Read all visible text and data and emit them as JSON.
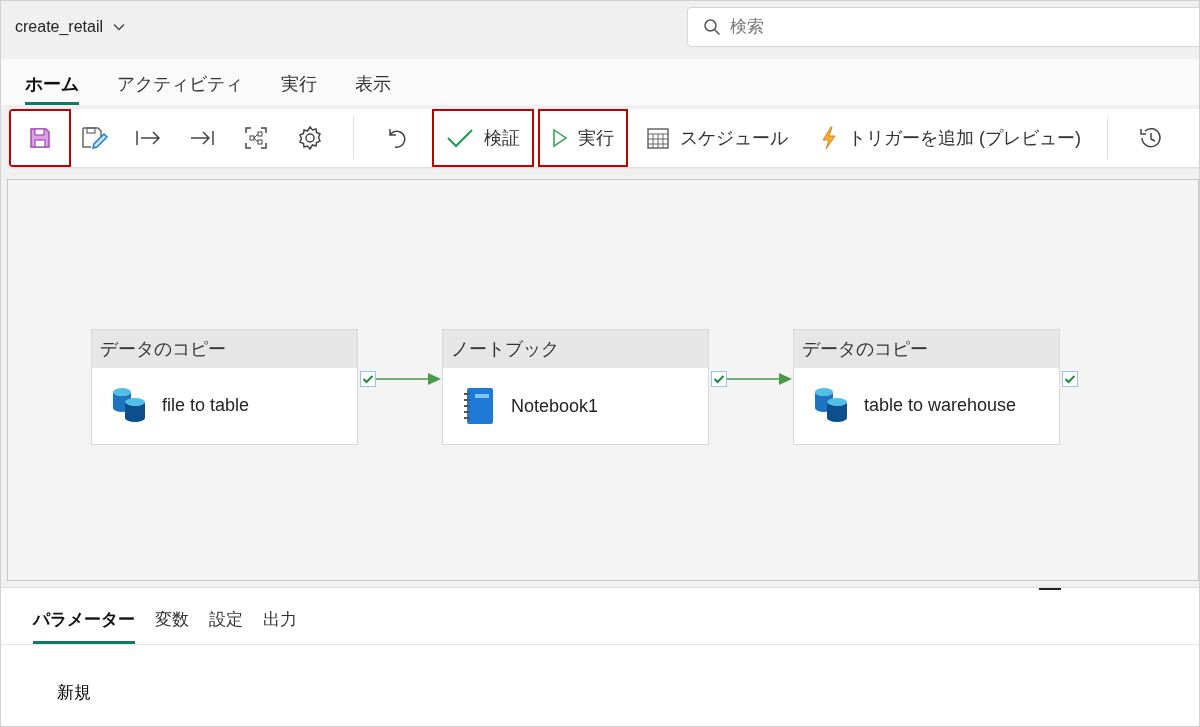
{
  "header": {
    "title": "create_retail",
    "search": {
      "placeholder": "検索"
    }
  },
  "tabs": [
    {
      "label": "ホーム",
      "selected": true
    },
    {
      "label": "アクティビティ",
      "selected": false
    },
    {
      "label": "実行",
      "selected": false
    },
    {
      "label": "表示",
      "selected": false
    }
  ],
  "toolbar": [
    {
      "kind": "save",
      "highlighted": true
    },
    {
      "kind": "save-as",
      "highlighted": false
    },
    {
      "kind": "step-in",
      "highlighted": false
    },
    {
      "kind": "step-end",
      "highlighted": false
    },
    {
      "kind": "nodes",
      "highlighted": false
    },
    {
      "kind": "settings",
      "highlighted": false
    },
    {
      "kind": "separator"
    },
    {
      "kind": "undo",
      "highlighted": false
    },
    {
      "kind": "validate",
      "label": "検証",
      "highlighted": true
    },
    {
      "kind": "run",
      "label": "実行",
      "highlighted": true
    },
    {
      "kind": "schedule",
      "label": "スケジュール",
      "highlighted": false
    },
    {
      "kind": "trigger",
      "label": "トリガーを追加 (プレビュー)",
      "highlighted": false
    },
    {
      "kind": "separator"
    },
    {
      "kind": "history",
      "highlighted": false
    }
  ],
  "activities": [
    {
      "kind": "copy",
      "category": "データのコピー",
      "name": "file to table",
      "succeeded": true
    },
    {
      "kind": "notebook",
      "category": "ノートブック",
      "name": "Notebook1",
      "succeeded": true
    },
    {
      "kind": "copy",
      "category": "データのコピー",
      "name": "table to warehouse",
      "succeeded": true
    }
  ],
  "panel": {
    "tabs": [
      {
        "label": "パラメーター",
        "selected": true
      },
      {
        "label": "変数",
        "selected": false
      },
      {
        "label": "設定",
        "selected": false
      },
      {
        "label": "出力",
        "selected": false
      }
    ],
    "new_label": "新規"
  }
}
